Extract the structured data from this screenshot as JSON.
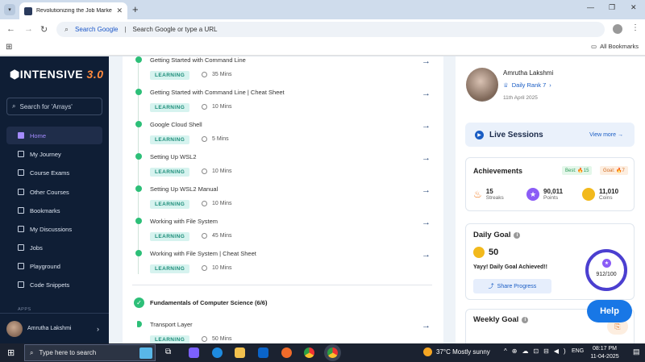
{
  "browser": {
    "tab_title": "Revolutionizing the Job Market",
    "omnibox_prefix": "Search Google",
    "omnibox_text": "Search Google or type a URL",
    "bookmarks_label": "All Bookmarks"
  },
  "sidebar": {
    "logo_main": "INTENSIVE",
    "logo_version": "3.0",
    "search_placeholder": "Search for 'Arrays'",
    "items": [
      {
        "label": "Home",
        "active": true
      },
      {
        "label": "My Journey"
      },
      {
        "label": "Course Exams"
      },
      {
        "label": "Other Courses"
      },
      {
        "label": "Bookmarks"
      },
      {
        "label": "My Discussions"
      },
      {
        "label": "Jobs"
      },
      {
        "label": "Playground"
      },
      {
        "label": "Code Snippets"
      }
    ],
    "section_label": "APPS",
    "user_name": "Amrutha Lakshmi"
  },
  "lessons": [
    {
      "title": "Getting Started with Command Line",
      "badge": "LEARNING",
      "duration": "35 Mins"
    },
    {
      "title": "Getting Started with Command Line | Cheat Sheet",
      "badge": "LEARNING",
      "duration": "10 Mins"
    },
    {
      "title": "Google Cloud Shell",
      "badge": "LEARNING",
      "duration": "5 Mins"
    },
    {
      "title": "Setting Up WSL2",
      "badge": "LEARNING",
      "duration": "10 Mins"
    },
    {
      "title": "Setting Up WSL2 Manual",
      "badge": "LEARNING",
      "duration": "10 Mins"
    },
    {
      "title": "Working with File System",
      "badge": "LEARNING",
      "duration": "45 Mins"
    },
    {
      "title": "Working with File System | Cheat Sheet",
      "badge": "LEARNING",
      "duration": "10 Mins"
    }
  ],
  "section2": {
    "title": "Fundamentals of Computer Science (6/6)",
    "lesson_title": "Transport Layer",
    "lesson_badge": "LEARNING",
    "lesson_duration": "50 Mins"
  },
  "profile": {
    "name": "Amrutha Lakshmi",
    "rank": "Daily Rank 7",
    "date": "11th April 2025"
  },
  "live": {
    "title": "Live Sessions",
    "link": "View more"
  },
  "achievements": {
    "title": "Achievements",
    "best": "Best: 🔥15",
    "goal": "Goal: 🔥7",
    "streaks_value": "15",
    "streaks_label": "Streaks",
    "points_value": "90,011",
    "points_label": "Points",
    "coins_value": "11,010",
    "coins_label": "Coins"
  },
  "daily_goal": {
    "title": "Daily Goal",
    "value": "50",
    "message": "Yayy! Daily Goal Achieved!!",
    "share": "Share Progress",
    "progress_text": "912/100",
    "progress_fraction": 1.0
  },
  "weekly_goal": {
    "title": "Weekly Goal"
  },
  "help_label": "Help",
  "taskbar": {
    "search_placeholder": "Type here to search",
    "weather": "37°C  Mostly sunny",
    "lang": "ENG",
    "time": "08:17 PM",
    "date": "11-04-2025"
  },
  "colors": {
    "accent": "#1877e6",
    "success": "#2dbf78",
    "sidebar_bg": "#0f1e35",
    "active_nav": "#a48bff"
  }
}
